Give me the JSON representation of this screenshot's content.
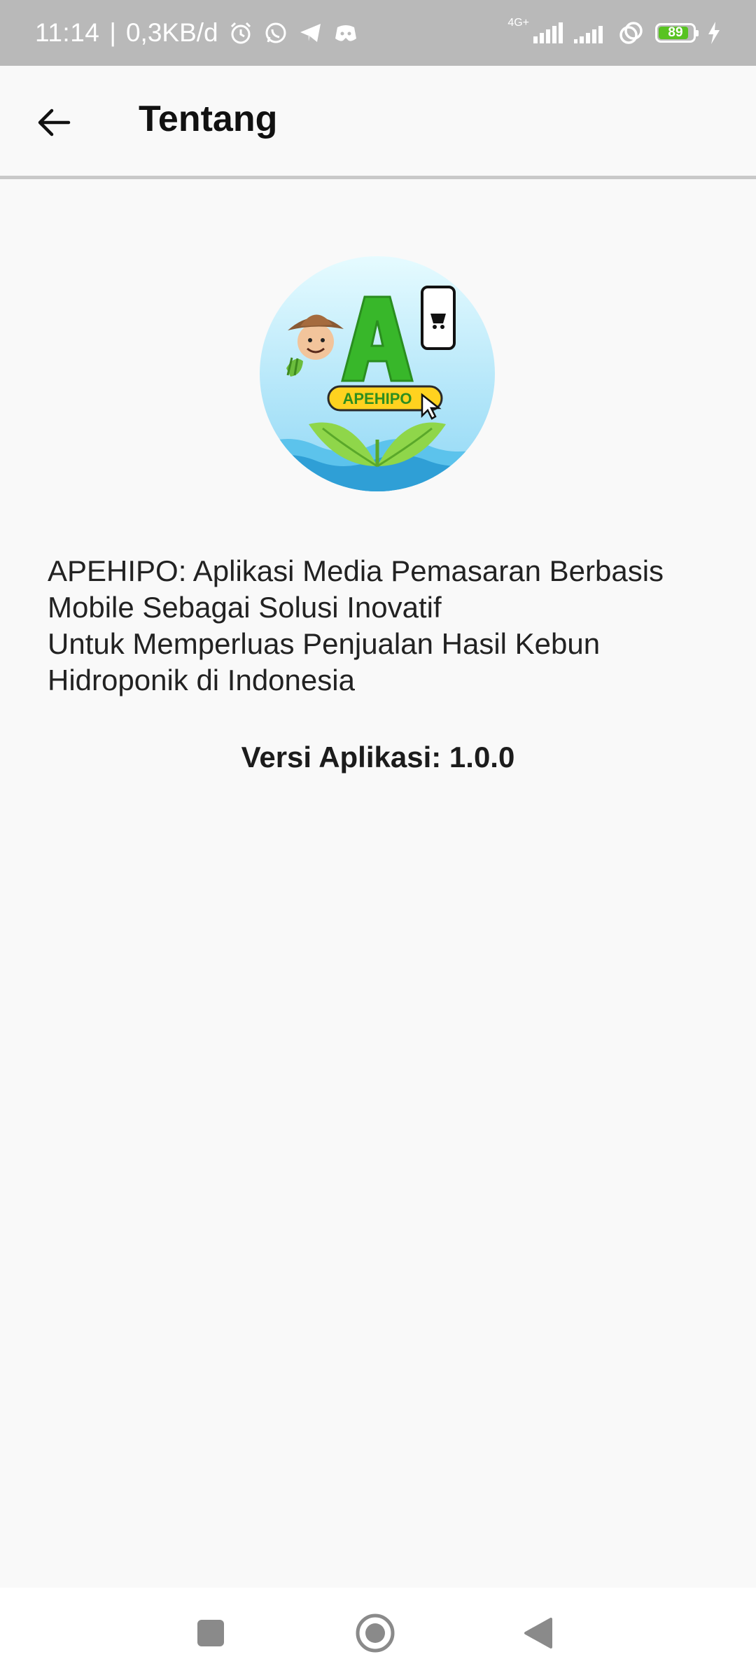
{
  "status_bar": {
    "time": "11:14",
    "separator": "|",
    "data_speed": "0,3KB/d",
    "network_label": "4G+",
    "battery_level": "89",
    "battery_percent": 89,
    "icons": [
      "alarm-icon",
      "whatsapp-icon",
      "telegram-icon",
      "discord-icon",
      "signal-icon",
      "signal-icon",
      "hotspot-icon",
      "battery-icon",
      "charging-icon"
    ]
  },
  "app_bar": {
    "title": "Tentang",
    "back_icon": "arrow-left-icon"
  },
  "logo": {
    "text": "APEHIPO",
    "letter": "A",
    "colors": {
      "circle_bg": "#c8eefb",
      "green": "#3fb82a",
      "yellow": "#ffd21f",
      "water": "#4db8e8"
    }
  },
  "content": {
    "description_lines": [
      "APEHIPO: Aplikasi Media Pemasaran Berbasis",
      "Mobile Sebagai Solusi Inovatif",
      "Untuk Memperluas Penjualan Hasil Kebun",
      "Hidroponik di Indonesia"
    ],
    "version": "Versi Aplikasi: 1.0.0"
  },
  "nav_bar": {
    "buttons": [
      "recents-icon",
      "home-icon",
      "back-triangle-icon"
    ]
  }
}
